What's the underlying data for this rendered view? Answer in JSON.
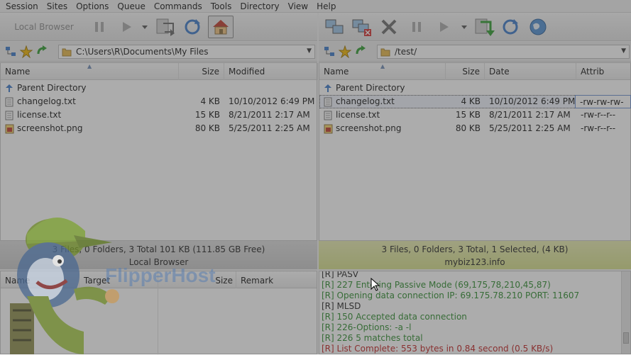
{
  "menu": [
    "Session",
    "Sites",
    "Options",
    "Queue",
    "Commands",
    "Tools",
    "Directory",
    "View",
    "Help"
  ],
  "toolbar_left": {
    "local_browser_label": "Local Browser"
  },
  "local_path": "C:\\Users\\R\\Documents\\My Files",
  "remote_path": "/test/",
  "local_columns": [
    "Name",
    "Size",
    "Modified"
  ],
  "remote_columns": [
    "Name",
    "Size",
    "Date",
    "Attrib"
  ],
  "local_files": [
    {
      "name": "Parent Directory",
      "size": "",
      "modified": "",
      "icon": "up-arrow-icon"
    },
    {
      "name": "changelog.txt",
      "size": "4 KB",
      "modified": "10/10/2012 6:49 PM",
      "icon": "text-file-icon"
    },
    {
      "name": "license.txt",
      "size": "15 KB",
      "modified": "8/21/2011 2:17 AM",
      "icon": "text-file-icon"
    },
    {
      "name": "screenshot.png",
      "size": "80 KB",
      "modified": "5/25/2011 2:25 AM",
      "icon": "image-file-icon"
    }
  ],
  "remote_files": [
    {
      "name": "Parent Directory",
      "size": "",
      "date": "",
      "attrib": "",
      "icon": "up-arrow-icon"
    },
    {
      "name": "changelog.txt",
      "size": "4 KB",
      "date": "10/10/2012 6:49 PM",
      "attrib": "-rw-rw-rw-",
      "icon": "text-file-icon"
    },
    {
      "name": "license.txt",
      "size": "15 KB",
      "date": "8/21/2011 2:17 AM",
      "attrib": "-rw-r--r--",
      "icon": "text-file-icon"
    },
    {
      "name": "screenshot.png",
      "size": "80 KB",
      "date": "5/25/2011 2:25 AM",
      "attrib": "-rw-r--r--",
      "icon": "image-file-icon"
    }
  ],
  "local_status": {
    "summary": "3 Files, 0 Folders, 3 Total 101 KB (111.85 GB Free)",
    "label": "Local Browser"
  },
  "remote_status": {
    "summary": "3 Files, 0 Folders, 3 Total, 1 Selected, (4 KB)",
    "label": "mybiz123.info"
  },
  "queue_columns": [
    "Name",
    "Target",
    "Size",
    "Remark"
  ],
  "log_lines": [
    {
      "text": "[R] PASV",
      "type": "k"
    },
    {
      "text": "[R] 227 Entering Passive Mode (69,175,78,210,45,87)",
      "type": "g"
    },
    {
      "text": "[R] Opening data connection IP: 69.175.78.210 PORT: 11607",
      "type": "g"
    },
    {
      "text": "[R] MLSD",
      "type": "k"
    },
    {
      "text": "[R] 150 Accepted data connection",
      "type": "g"
    },
    {
      "text": "[R] 226-Options: -a -l",
      "type": "g"
    },
    {
      "text": "[R] 226 5 matches total",
      "type": "g"
    },
    {
      "text": "[R] List Complete: 553 bytes in 0.84 second (0.5 KB/s)",
      "type": "rd"
    }
  ],
  "watermark": "FlipperHost",
  "colors": {
    "log_green": "#2a8a2a",
    "log_red": "#c02020",
    "remote_status_bg": "#d6df8a"
  }
}
